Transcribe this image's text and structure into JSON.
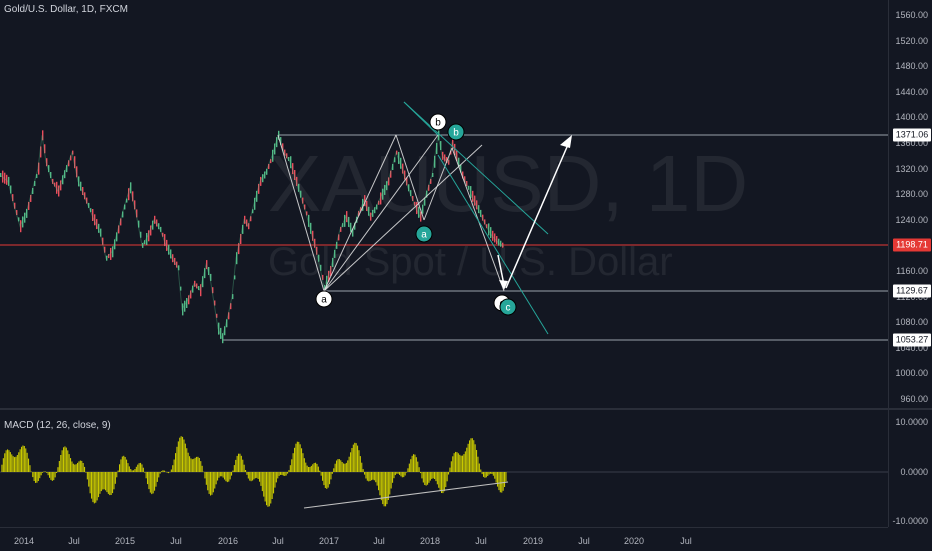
{
  "chart": {
    "legend": "Gold/U.S. Dollar, 1D, FXCM",
    "watermark_symbol": "XAUUSD, 1D",
    "watermark_name": "Gold Spot / U.S. Dollar"
  },
  "macd": {
    "legend": "MACD (12, 26, close, 9)"
  },
  "price_axis": {
    "ticks": [
      "1560.00",
      "1520.00",
      "1480.00",
      "1440.00",
      "1400.00",
      "1360.00",
      "1320.00",
      "1280.00",
      "1240.00",
      "1200.00",
      "1160.00",
      "1120.00",
      "1080.00",
      "1040.00",
      "1000.00",
      "960.00"
    ],
    "tags": {
      "resistance": "1371.06",
      "current": "1198.71",
      "support_mid": "1129.67",
      "support_low": "1053.27"
    }
  },
  "macd_axis": {
    "ticks": [
      "10.0000",
      "0.0000",
      "-10.0000"
    ]
  },
  "time_axis": {
    "labels": [
      "2014",
      "Jul",
      "2015",
      "Jul",
      "2016",
      "Jul",
      "2017",
      "Jul",
      "2018",
      "Jul",
      "2019",
      "Jul",
      "2020",
      "Jul"
    ]
  },
  "wave_labels": {
    "a_white": "a",
    "b_white": "b",
    "c_white": "c",
    "a_teal": "a",
    "b_teal": "b",
    "c_teal": "c"
  },
  "colors": {
    "background": "#131722",
    "up_candle": "#53b987",
    "down_candle": "#eb4d5c",
    "macd_histogram": "#c8c800",
    "current_price_line": "#e53935",
    "teal_lines": "#26a69a"
  }
}
